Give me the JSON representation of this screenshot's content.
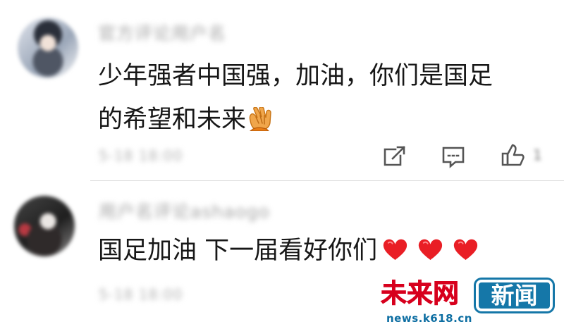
{
  "comments": [
    {
      "username_blurred": "官方评论用户名",
      "text_line_1": "少年强者中国强，加油，你们是国足",
      "text_line_2": "的希望和未来",
      "emoji": "clapping-hands-icon",
      "time_blurred": "5-18 18:00",
      "actions": {
        "share": "share-icon",
        "reply": "reply-icon",
        "like": "thumb-up-icon",
        "like_count_blurred": "1"
      }
    },
    {
      "username_blurred": "用户名评论ashaogo",
      "text": "国足加油  下一届看好你们",
      "emoji": [
        "heart-icon",
        "heart-icon",
        "heart-icon"
      ],
      "time_blurred": "5-18 18:00"
    }
  ],
  "watermark": {
    "red_text": "未来网",
    "blue_text": "新闻",
    "domain": "news.k618.cn",
    "colors": {
      "red": "#d7001d",
      "blue": "#1577a8"
    }
  }
}
